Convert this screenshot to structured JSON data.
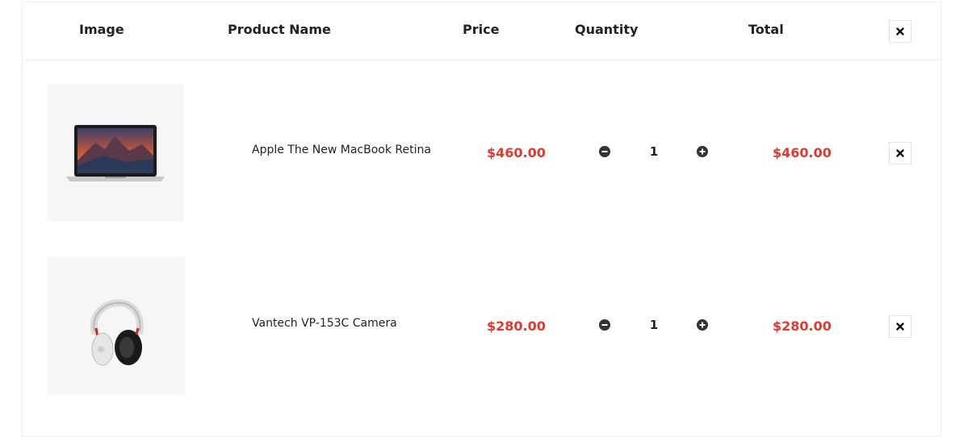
{
  "header": {
    "image": "Image",
    "product_name": "Product Name",
    "price": "Price",
    "quantity": "Quantity",
    "total": "Total",
    "remove_icon": "close-icon"
  },
  "items": [
    {
      "name": "Apple The New MacBook Retina",
      "price": "$460.00",
      "quantity": "1",
      "total": "$460.00",
      "image_icon": "laptop-image"
    },
    {
      "name": "Vantech VP-153C Camera",
      "price": "$280.00",
      "quantity": "1",
      "total": "$280.00",
      "image_icon": "headphones-image"
    }
  ],
  "colors": {
    "price": "#e03a2f",
    "border": "#ededed",
    "thumb_bg": "#f6f6f6"
  }
}
